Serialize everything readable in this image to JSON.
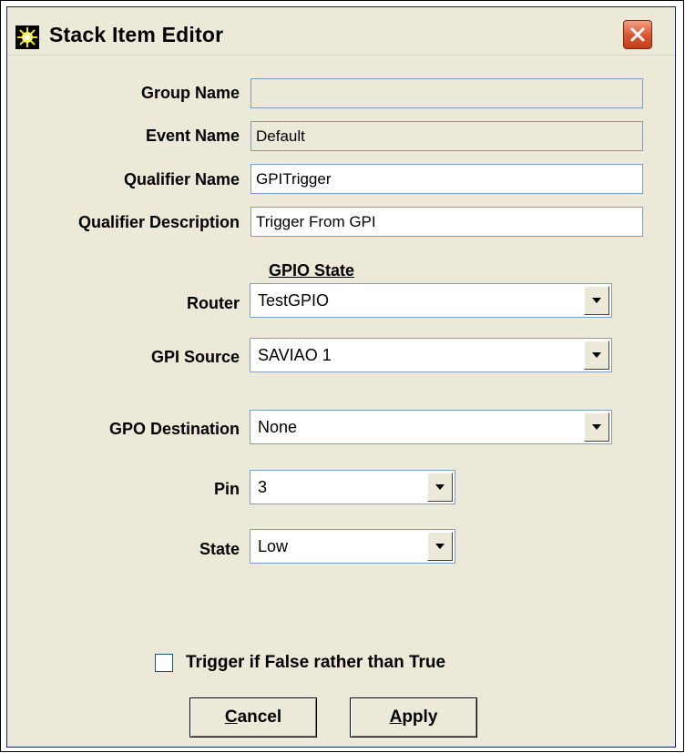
{
  "window": {
    "title": "Stack Item Editor",
    "close_label": "X"
  },
  "fields": {
    "group_name": {
      "label": "Group Name",
      "value": ""
    },
    "event_name": {
      "label": "Event Name",
      "value": "Default"
    },
    "qualifier_name": {
      "label": "Qualifier Name",
      "value": "GPITrigger"
    },
    "qualifier_description": {
      "label": "Qualifier Description",
      "value": "Trigger From GPI"
    }
  },
  "gpio": {
    "heading": "GPIO State",
    "router": {
      "label": "Router",
      "value": "TestGPIO"
    },
    "gpi_source": {
      "label": "GPI Source",
      "value": "SAVIAO 1"
    },
    "gpo_destination": {
      "label": "GPO Destination",
      "value": "None"
    },
    "pin": {
      "label": "Pin",
      "value": "3"
    },
    "state": {
      "label": "State",
      "value": "Low"
    }
  },
  "trigger_checkbox": {
    "label": "Trigger if False rather than True",
    "checked": false
  },
  "buttons": {
    "cancel": {
      "mnemonic": "C",
      "rest": "ancel"
    },
    "apply": {
      "mnemonic": "A",
      "rest": "pply"
    }
  },
  "icons": {
    "app": "starburst-icon",
    "close": "close-icon",
    "dropdown": "chevron-down-icon"
  }
}
